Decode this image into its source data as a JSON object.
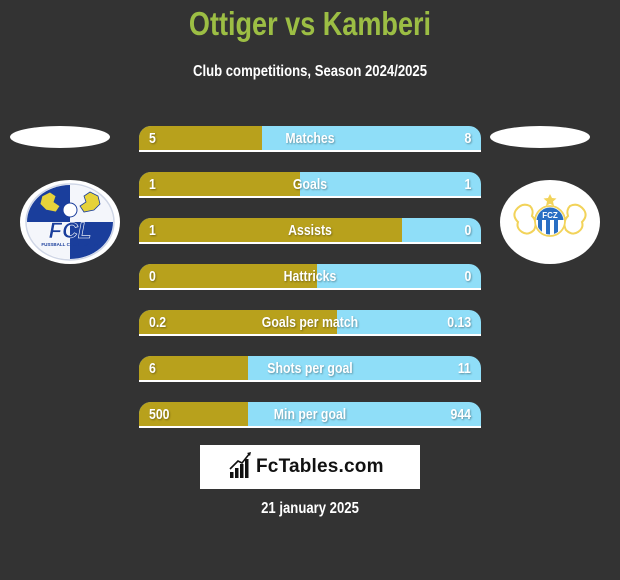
{
  "header": {
    "title": "Ottiger vs Kamberi",
    "subtitle": "Club competitions, Season 2024/2025"
  },
  "teams": {
    "left": {
      "name": "FC Luzern",
      "logo_icon": "fc-luzern-crest-icon",
      "logo_text": "FCL",
      "logo_subtext": "FUSSBALL CLUB LUZERN"
    },
    "right": {
      "name": "FC Zürich",
      "logo_icon": "fc-zurich-crest-icon",
      "logo_text": "FCZ"
    }
  },
  "colors": {
    "background": "#333333",
    "title": "#9cbe44",
    "left_bar": "#b8a11c",
    "right_bar": "#8fdef8",
    "text": "#ffffff"
  },
  "stats": [
    {
      "label": "Matches",
      "left": "5",
      "right": "8",
      "left_fill": 0.36
    },
    {
      "label": "Goals",
      "left": "1",
      "right": "1",
      "left_fill": 0.47
    },
    {
      "label": "Assists",
      "left": "1",
      "right": "0",
      "left_fill": 0.77
    },
    {
      "label": "Hattricks",
      "left": "0",
      "right": "0",
      "left_fill": 0.52
    },
    {
      "label": "Goals per match",
      "left": "0.2",
      "right": "0.13",
      "left_fill": 0.58
    },
    {
      "label": "Shots per goal",
      "left": "6",
      "right": "11",
      "left_fill": 0.32
    },
    {
      "label": "Min per goal",
      "left": "500",
      "right": "944",
      "left_fill": 0.32
    }
  ],
  "footer": {
    "brand": "FcTables.com",
    "brand_icon": "bar-chart-trend-icon",
    "date": "21 january 2025"
  }
}
